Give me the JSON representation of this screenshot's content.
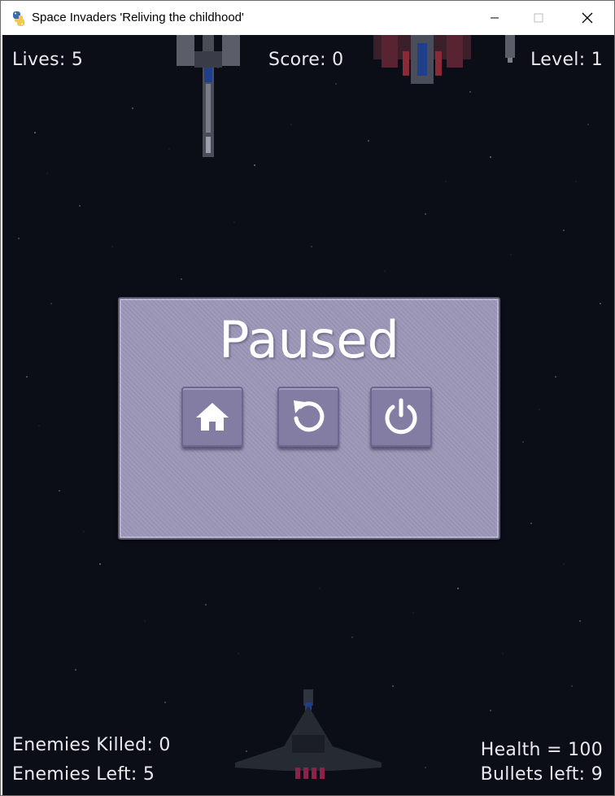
{
  "window": {
    "title": "Space Invaders 'Reliving the childhood'",
    "app_icon": "python-icon",
    "controls": [
      "minimize-icon",
      "maximize-icon",
      "close-icon"
    ]
  },
  "hud": {
    "lives": "Lives: 5",
    "score": "Score: 0",
    "level": "Level: 1",
    "enemies_killed": "Enemies Killed: 0",
    "enemies_left": "Enemies Left: 5",
    "health": "Health = 100",
    "bullets_left": "Bullets left: 9"
  },
  "pause_menu": {
    "title": "Paused",
    "buttons": [
      {
        "name": "home-button",
        "icon": "home-icon"
      },
      {
        "name": "restart-button",
        "icon": "restart-icon"
      },
      {
        "name": "quit-button",
        "icon": "power-icon"
      }
    ]
  },
  "colors": {
    "background": "#0b0e17",
    "panel": "#9d97b9",
    "button": "#837da3",
    "hud_text": "#e9e9ee"
  }
}
